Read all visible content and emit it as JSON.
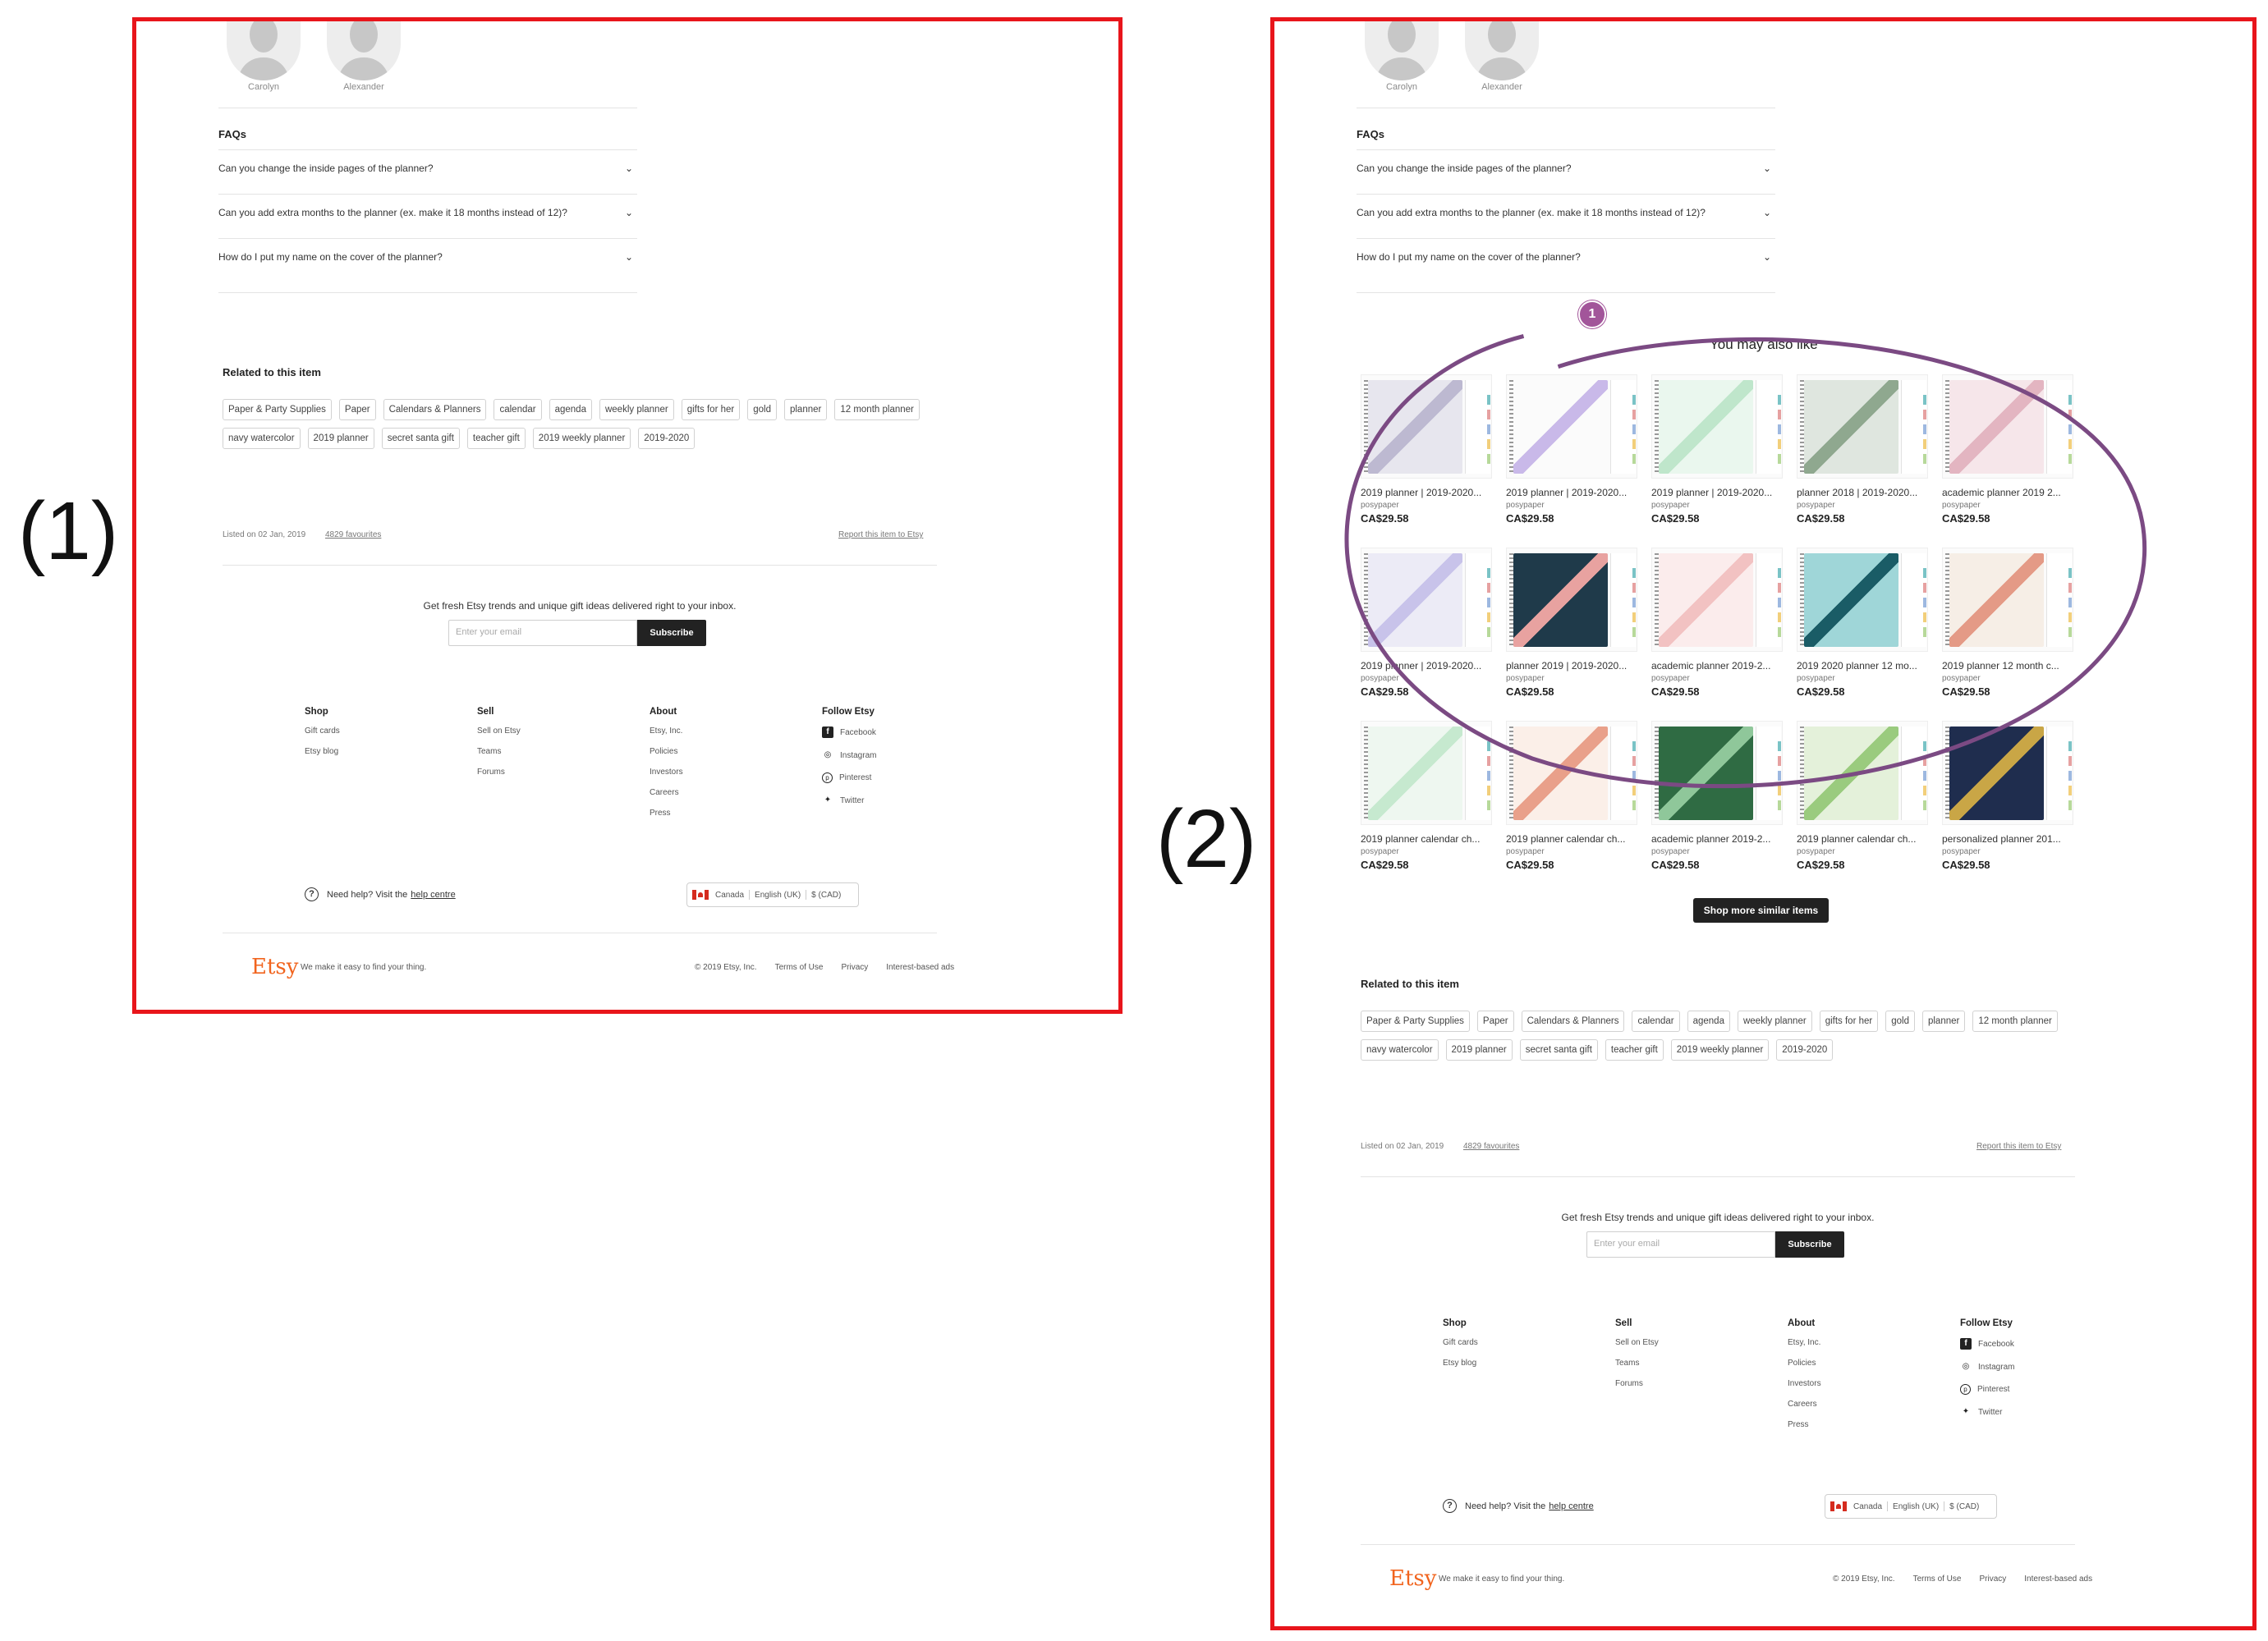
{
  "panel_labels": [
    "(1)",
    "(2)"
  ],
  "reviewers": [
    "Carolyn",
    "Alexander"
  ],
  "faqs": {
    "heading": "FAQs",
    "questions": [
      "Can you change the inside pages of the planner?",
      "Can you add extra months to the planner (ex. make it 18 months instead of 12)?",
      "How do I put my name on the cover of the planner?"
    ]
  },
  "related": {
    "heading": "Related to this item",
    "tags": [
      "Paper & Party Supplies",
      "Paper",
      "Calendars & Planners",
      "calendar",
      "agenda",
      "weekly planner",
      "gifts for her",
      "gold",
      "planner",
      "12 month planner",
      "navy watercolor",
      "2019 planner",
      "secret santa gift",
      "teacher gift",
      "2019 weekly planner",
      "2019-2020"
    ]
  },
  "listing": {
    "listed_on": "Listed on 02 Jan, 2019",
    "favourites": "4829 favourites",
    "report": "Report this item to Etsy"
  },
  "newsletter": {
    "text": "Get fresh Etsy trends and unique gift ideas delivered right to your inbox.",
    "placeholder": "Enter your email",
    "button": "Subscribe"
  },
  "footer": {
    "columns": [
      {
        "heading": "Shop",
        "items": [
          "Gift cards",
          "Etsy blog"
        ]
      },
      {
        "heading": "Sell",
        "items": [
          "Sell on Etsy",
          "Teams",
          "Forums"
        ]
      },
      {
        "heading": "About",
        "items": [
          "Etsy, Inc.",
          "Policies",
          "Investors",
          "Careers",
          "Press"
        ]
      }
    ],
    "follow": {
      "heading": "Follow Etsy",
      "items": [
        {
          "label": "Facebook",
          "icon": "facebook-icon"
        },
        {
          "label": "Instagram",
          "icon": "instagram-icon"
        },
        {
          "label": "Pinterest",
          "icon": "pinterest-icon"
        },
        {
          "label": "Twitter",
          "icon": "twitter-icon"
        }
      ]
    },
    "help_prefix": "Need help? Visit the",
    "help_link": "help centre",
    "region": {
      "country": "Canada",
      "language": "English (UK)",
      "currency": "$ (CAD)"
    },
    "logo": "Etsy",
    "tagline": "We make it easy to find your thing.",
    "copyright": "© 2019 Etsy, Inc.",
    "terms": "Terms of Use",
    "privacy": "Privacy",
    "ads": "Interest-based ads"
  },
  "you_may_also_like": {
    "heading": "You may also like",
    "annotation_badge": "1",
    "annotation_color": "#7b4a83",
    "shop_more": "Shop more similar items",
    "products": [
      {
        "title": "2019 planner | 2019-2020...",
        "shop": "posypaper",
        "price": "CA$29.58",
        "cover": "#e7e6ee",
        "accent": "#bdb9d1"
      },
      {
        "title": "2019 planner | 2019-2020...",
        "shop": "posypaper",
        "price": "CA$29.58",
        "cover": "#fbfbfb",
        "accent": "#c9b9e9"
      },
      {
        "title": "2019 planner | 2019-2020...",
        "shop": "posypaper",
        "price": "CA$29.58",
        "cover": "#eaf7ee",
        "accent": "#bfe6cb"
      },
      {
        "title": "planner 2018 | 2019-2020...",
        "shop": "posypaper",
        "price": "CA$29.58",
        "cover": "#dfe6df",
        "accent": "#8fa88f"
      },
      {
        "title": "academic planner 2019 2...",
        "shop": "posypaper",
        "price": "CA$29.58",
        "cover": "#f6e6ea",
        "accent": "#e3b5c1"
      },
      {
        "title": "2019 planner | 2019-2020...",
        "shop": "posypaper",
        "price": "CA$29.58",
        "cover": "#ecebf6",
        "accent": "#c8c3ea"
      },
      {
        "title": "planner 2019 | 2019-2020...",
        "shop": "posypaper",
        "price": "CA$29.58",
        "cover": "#1f3a4a",
        "accent": "#e8a2a0"
      },
      {
        "title": "academic planner 2019-2...",
        "shop": "posypaper",
        "price": "CA$29.58",
        "cover": "#fbecec",
        "accent": "#f2c2c2"
      },
      {
        "title": "2019 2020 planner 12 mo...",
        "shop": "posypaper",
        "price": "CA$29.58",
        "cover": "#9fd6d8",
        "accent": "#1a5c66"
      },
      {
        "title": "2019 planner 12 month c...",
        "shop": "posypaper",
        "price": "CA$29.58",
        "cover": "#f6eee6",
        "accent": "#e49a86"
      },
      {
        "title": "2019 planner calendar ch...",
        "shop": "posypaper",
        "price": "CA$29.58",
        "cover": "#eef7f0",
        "accent": "#c6e9cf"
      },
      {
        "title": "2019 planner calendar ch...",
        "shop": "posypaper",
        "price": "CA$29.58",
        "cover": "#fbefe8",
        "accent": "#e9a08a"
      },
      {
        "title": "academic planner 2019-2...",
        "shop": "posypaper",
        "price": "CA$29.58",
        "cover": "#2f6b43",
        "accent": "#8fc79a"
      },
      {
        "title": "2019 planner calendar ch...",
        "shop": "posypaper",
        "price": "CA$29.58",
        "cover": "#e4f1da",
        "accent": "#9acb7e"
      },
      {
        "title": "personalized planner 201...",
        "shop": "posypaper",
        "price": "CA$29.58",
        "cover": "#1f2d4e",
        "accent": "#c9a646"
      }
    ]
  }
}
